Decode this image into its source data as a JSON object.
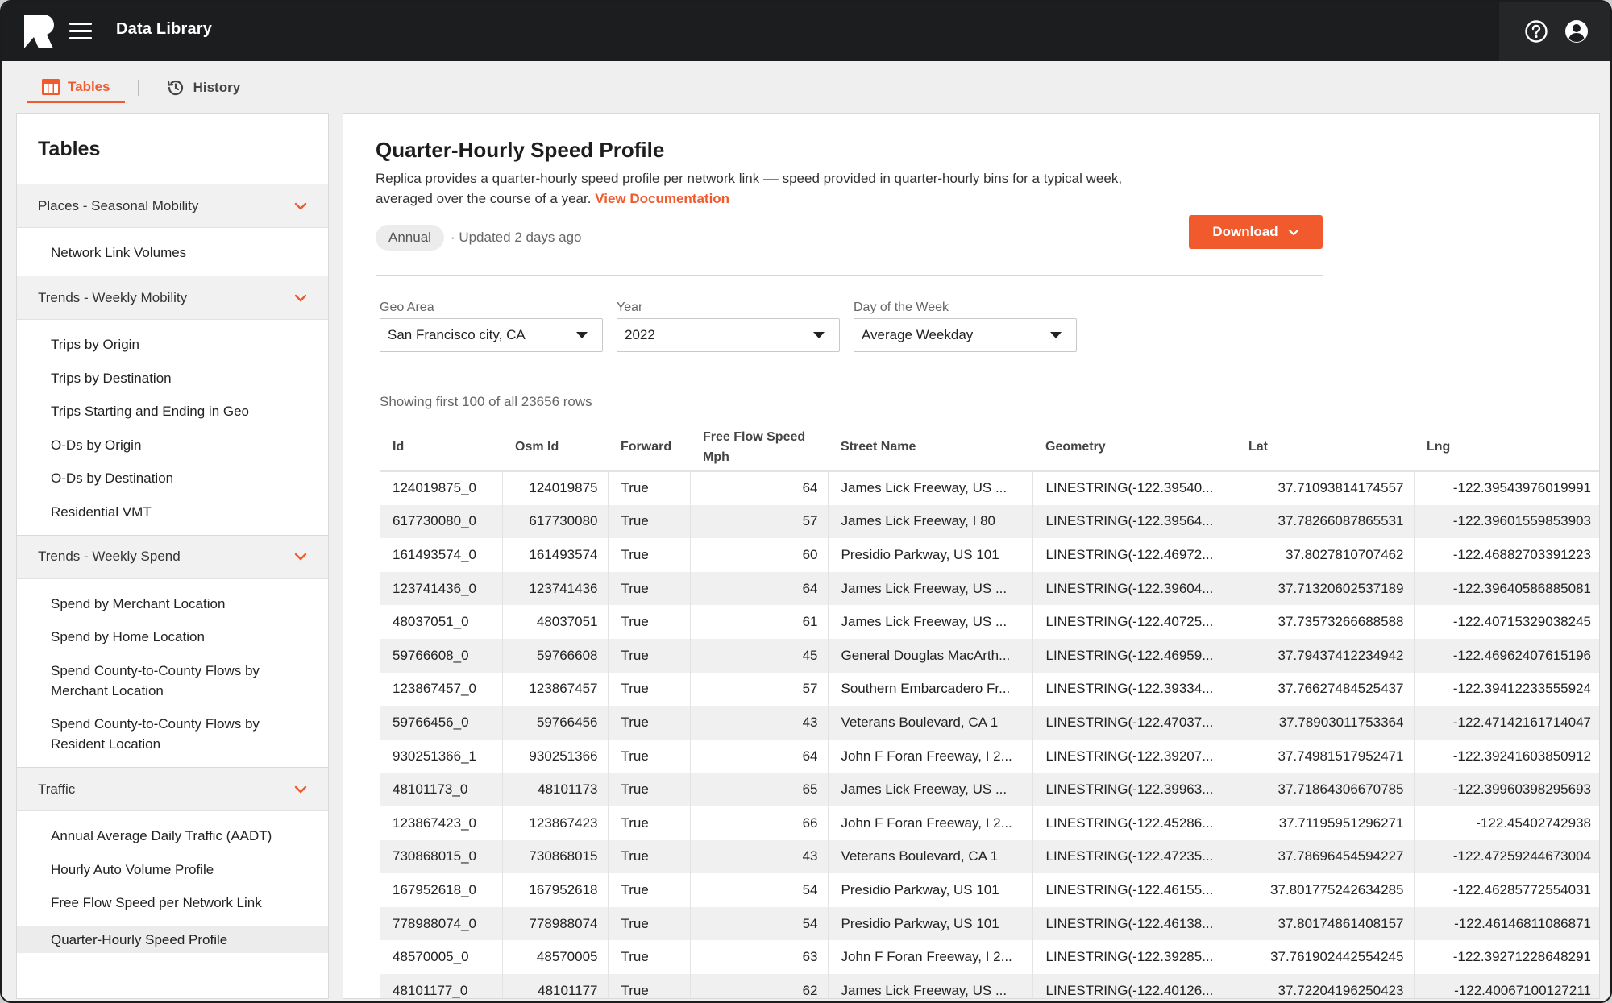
{
  "app": {
    "title": "Data Library"
  },
  "subtabs": [
    {
      "label": "Tables",
      "icon": "table-icon",
      "active": true
    },
    {
      "label": "History",
      "icon": "history-icon",
      "active": false
    }
  ],
  "sidebar": {
    "title": "Tables",
    "groups": [
      {
        "label": "Places - Seasonal Mobility",
        "items": [
          "Network Link Volumes"
        ]
      },
      {
        "label": "Trends - Weekly Mobility",
        "items": [
          "Trips by Origin",
          "Trips by Destination",
          "Trips Starting and Ending in Geo",
          "O-Ds by Origin",
          "O-Ds by Destination",
          "Residential VMT"
        ]
      },
      {
        "label": "Trends - Weekly Spend",
        "items": [
          "Spend by Merchant Location",
          "Spend by Home Location",
          "Spend County-to-County Flows by Merchant Location",
          "Spend County-to-County Flows by Resident Location"
        ]
      },
      {
        "label": "Traffic",
        "items": [
          "Annual Average Daily Traffic (AADT)",
          "Hourly Auto Volume Profile",
          "Free Flow Speed per Network Link",
          "Quarter-Hourly Speed Profile"
        ]
      }
    ]
  },
  "main": {
    "title": "Quarter-Hourly Speed Profile",
    "description": "Replica provides a quarter-hourly speed profile per network link –– speed provided in quarter-hourly bins for a typical week, averaged over the course of a year.",
    "doc_link": "View Documentation",
    "badge": "Annual",
    "updated": "· Updated 2 days ago",
    "download_label": "Download",
    "filters": [
      {
        "label": "Geo Area",
        "value": "San Francisco city, CA"
      },
      {
        "label": "Year",
        "value": "2022"
      },
      {
        "label": "Day of the Week",
        "value": "Average Weekday"
      }
    ],
    "row_count": "Showing first 100 of all 23656 rows"
  },
  "table": {
    "columns": [
      "Id",
      "Osm Id",
      "Forward",
      "Free Flow Speed Mph",
      "Street Name",
      "Geometry",
      "Lat",
      "Lng"
    ],
    "rows": [
      [
        "124019875_0",
        "124019875",
        "True",
        "64",
        "James Lick Freeway, US ...",
        "LINESTRING(-122.39540...",
        "37.71093814174557",
        "-122.39543976019991"
      ],
      [
        "617730080_0",
        "617730080",
        "True",
        "57",
        "James Lick Freeway, I 80",
        "LINESTRING(-122.39564...",
        "37.78266087865531",
        "-122.39601559853903"
      ],
      [
        "161493574_0",
        "161493574",
        "True",
        "60",
        "Presidio Parkway, US 101",
        "LINESTRING(-122.46972...",
        "37.8027810707462",
        "-122.46882703391223"
      ],
      [
        "123741436_0",
        "123741436",
        "True",
        "64",
        "James Lick Freeway, US ...",
        "LINESTRING(-122.39604...",
        "37.71320602537189",
        "-122.39640586885081"
      ],
      [
        "48037051_0",
        "48037051",
        "True",
        "61",
        "James Lick Freeway, US ...",
        "LINESTRING(-122.40725...",
        "37.73573266688588",
        "-122.40715329038245"
      ],
      [
        "59766608_0",
        "59766608",
        "True",
        "45",
        "General Douglas MacArth...",
        "LINESTRING(-122.46959...",
        "37.79437412234942",
        "-122.46962407615196"
      ],
      [
        "123867457_0",
        "123867457",
        "True",
        "57",
        "Southern Embarcadero Fr...",
        "LINESTRING(-122.39334...",
        "37.76627484525437",
        "-122.39412233555924"
      ],
      [
        "59766456_0",
        "59766456",
        "True",
        "43",
        "Veterans Boulevard, CA 1",
        "LINESTRING(-122.47037...",
        "37.78903011753364",
        "-122.47142161714047"
      ],
      [
        "930251366_1",
        "930251366",
        "True",
        "64",
        "John F Foran Freeway, I 2...",
        "LINESTRING(-122.39207...",
        "37.74981517952471",
        "-122.39241603850912"
      ],
      [
        "48101173_0",
        "48101173",
        "True",
        "65",
        "James Lick Freeway, US ...",
        "LINESTRING(-122.39963...",
        "37.71864306670785",
        "-122.39960398295693"
      ],
      [
        "123867423_0",
        "123867423",
        "True",
        "66",
        "John F Foran Freeway, I 2...",
        "LINESTRING(-122.45286...",
        "37.71195951296271",
        "-122.45402742938"
      ],
      [
        "730868015_0",
        "730868015",
        "True",
        "43",
        "Veterans Boulevard, CA 1",
        "LINESTRING(-122.47235...",
        "37.78696454594227",
        "-122.47259244673004"
      ],
      [
        "167952618_0",
        "167952618",
        "True",
        "54",
        "Presidio Parkway, US 101",
        "LINESTRING(-122.46155...",
        "37.801775242634285",
        "-122.46285772554031"
      ],
      [
        "778988074_0",
        "778988074",
        "True",
        "54",
        "Presidio Parkway, US 101",
        "LINESTRING(-122.46138...",
        "37.80174861408157",
        "-122.46146811086871"
      ],
      [
        "48570005_0",
        "48570005",
        "True",
        "63",
        "John F Foran Freeway, I 2...",
        "LINESTRING(-122.39285...",
        "37.761902442554245",
        "-122.39271228648291"
      ],
      [
        "48101177_0",
        "48101177",
        "True",
        "62",
        "James Lick Freeway, US ...",
        "LINESTRING(-122.40126...",
        "37.72204196250423",
        "-122.40067100127211"
      ]
    ]
  },
  "colors": {
    "accent": "#f05a2c",
    "topbar": "#1b1d1e"
  }
}
